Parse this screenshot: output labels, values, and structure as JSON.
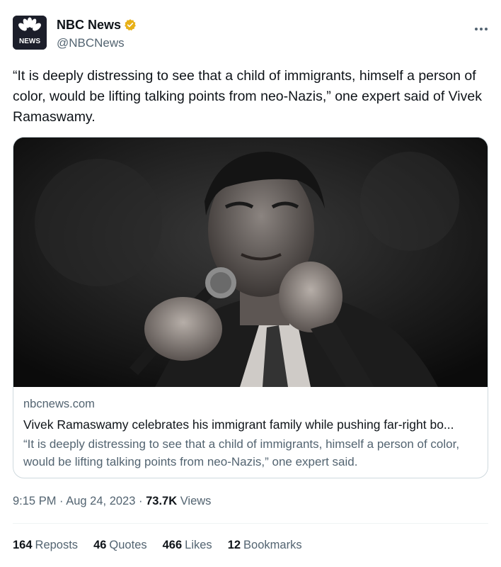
{
  "account": {
    "display_name": "NBC News",
    "handle": "@NBCNews",
    "logo_text": "NEWS",
    "verified_color": "#e8b118"
  },
  "tweet": {
    "text": "“It is deeply distressing to see that a child of immigrants, himself a person of color, would be lifting talking points from neo-Nazis,” one expert said of Vivek Ramaswamy."
  },
  "card": {
    "domain": "nbcnews.com",
    "title": "Vivek Ramaswamy celebrates his immigrant family while pushing far-right bo...",
    "description": "“It is deeply distressing to see that a child of immigrants, himself a person of color, would be lifting talking points from neo-Nazis,” one expert said."
  },
  "meta": {
    "time": "9:15 PM",
    "separator": "·",
    "date": "Aug 24, 2023",
    "views_count": "73.7K",
    "views_label": "Views"
  },
  "stats": {
    "reposts_count": "164",
    "reposts_label": "Reposts",
    "quotes_count": "46",
    "quotes_label": "Quotes",
    "likes_count": "466",
    "likes_label": "Likes",
    "bookmarks_count": "12",
    "bookmarks_label": "Bookmarks"
  },
  "icons": {
    "more": "more-horizontal-icon",
    "verified": "verified-badge-icon",
    "logo": "nbc-peacock-logo"
  }
}
